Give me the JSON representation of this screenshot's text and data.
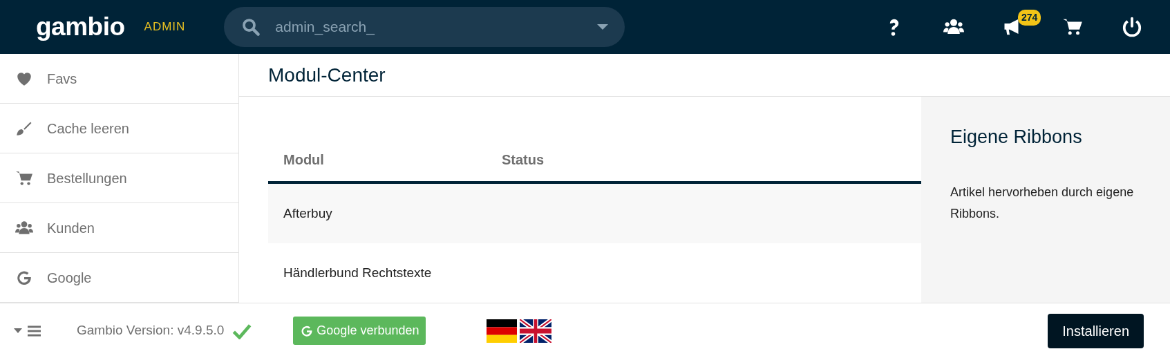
{
  "header": {
    "logo": "gambio",
    "subtitle": "ADMIN",
    "search": {
      "placeholder": "admin_search_"
    },
    "notifications_badge": "274"
  },
  "sidebar": {
    "items": [
      {
        "label": "Favs",
        "kind": "heart"
      },
      {
        "label": "Cache leeren",
        "kind": "brush"
      },
      {
        "label": "Bestellungen",
        "kind": "cart"
      },
      {
        "label": "Kunden",
        "kind": "users"
      },
      {
        "label": "Google",
        "kind": "google"
      }
    ]
  },
  "page_title": "Modul-Center",
  "table": {
    "columns": [
      "Modul",
      "Status"
    ],
    "rows": [
      {
        "cells": [
          "Afterbuy",
          ""
        ]
      },
      {
        "cells": [
          "Händlerbund Rechtstexte",
          ""
        ]
      }
    ]
  },
  "detail": {
    "title": "Eigene Ribbons",
    "description": "Artikel hervorheben durch eigene Ribbons."
  },
  "footer": {
    "version": "Gambio Version: v4.9.5.0",
    "google_button": "Google verbunden",
    "install_button": "Installieren"
  }
}
